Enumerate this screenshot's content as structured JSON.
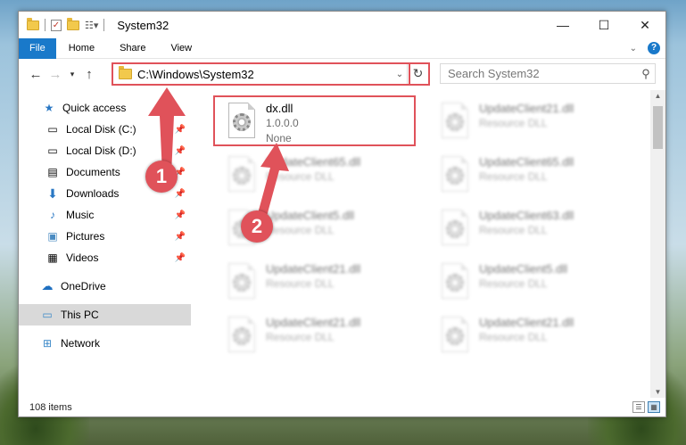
{
  "window": {
    "title": "System32",
    "controls": {
      "minimize": "—",
      "maximize": "☐",
      "close": "✕"
    }
  },
  "ribbon": {
    "tabs": [
      "File",
      "Home",
      "Share",
      "View"
    ],
    "help": "?"
  },
  "address": {
    "path": "C:\\Windows\\System32",
    "search_placeholder": "Search System32"
  },
  "sidebar": {
    "items": [
      {
        "label": "Quick access",
        "icon": "star-icon"
      },
      {
        "label": "Local Disk (C:)",
        "icon": "drive-icon",
        "pinned": true
      },
      {
        "label": "Local Disk (D:)",
        "icon": "drive-icon",
        "pinned": true
      },
      {
        "label": "Documents",
        "icon": "documents-icon",
        "pinned": true
      },
      {
        "label": "Downloads",
        "icon": "download-icon",
        "pinned": true
      },
      {
        "label": "Music",
        "icon": "music-icon",
        "pinned": true
      },
      {
        "label": "Pictures",
        "icon": "pictures-icon",
        "pinned": true
      },
      {
        "label": "Videos",
        "icon": "videos-icon",
        "pinned": true
      },
      {
        "label": "OneDrive",
        "icon": "cloud-icon"
      },
      {
        "label": "This PC",
        "icon": "computer-icon",
        "selected": true
      },
      {
        "label": "Network",
        "icon": "network-icon"
      }
    ]
  },
  "files": [
    {
      "name": "dx.dll",
      "line2": "1.0.0.0",
      "line3": "None",
      "clear": true
    },
    {
      "name": "UpdateClient21.dll",
      "line2": "Resource DLL"
    },
    {
      "name": "UpdateClient65.dll",
      "line2": "Resource DLL"
    },
    {
      "name": "UpdateClient65.dll",
      "line2": "Resource DLL"
    },
    {
      "name": "UpdateClient5.dll",
      "line2": "Resource DLL"
    },
    {
      "name": "UpdateClient63.dll",
      "line2": "Resource DLL"
    },
    {
      "name": "UpdateClient21.dll",
      "line2": "Resource DLL"
    },
    {
      "name": "UpdateClient5.dll",
      "line2": "Resource DLL"
    },
    {
      "name": "UpdateClient21.dll",
      "line2": "Resource DLL"
    },
    {
      "name": "UpdateClient21.dll",
      "line2": "Resource DLL"
    }
  ],
  "status": {
    "count": "108 items"
  },
  "annotations": {
    "badge1": "1",
    "badge2": "2",
    "color": "#e0525a"
  }
}
